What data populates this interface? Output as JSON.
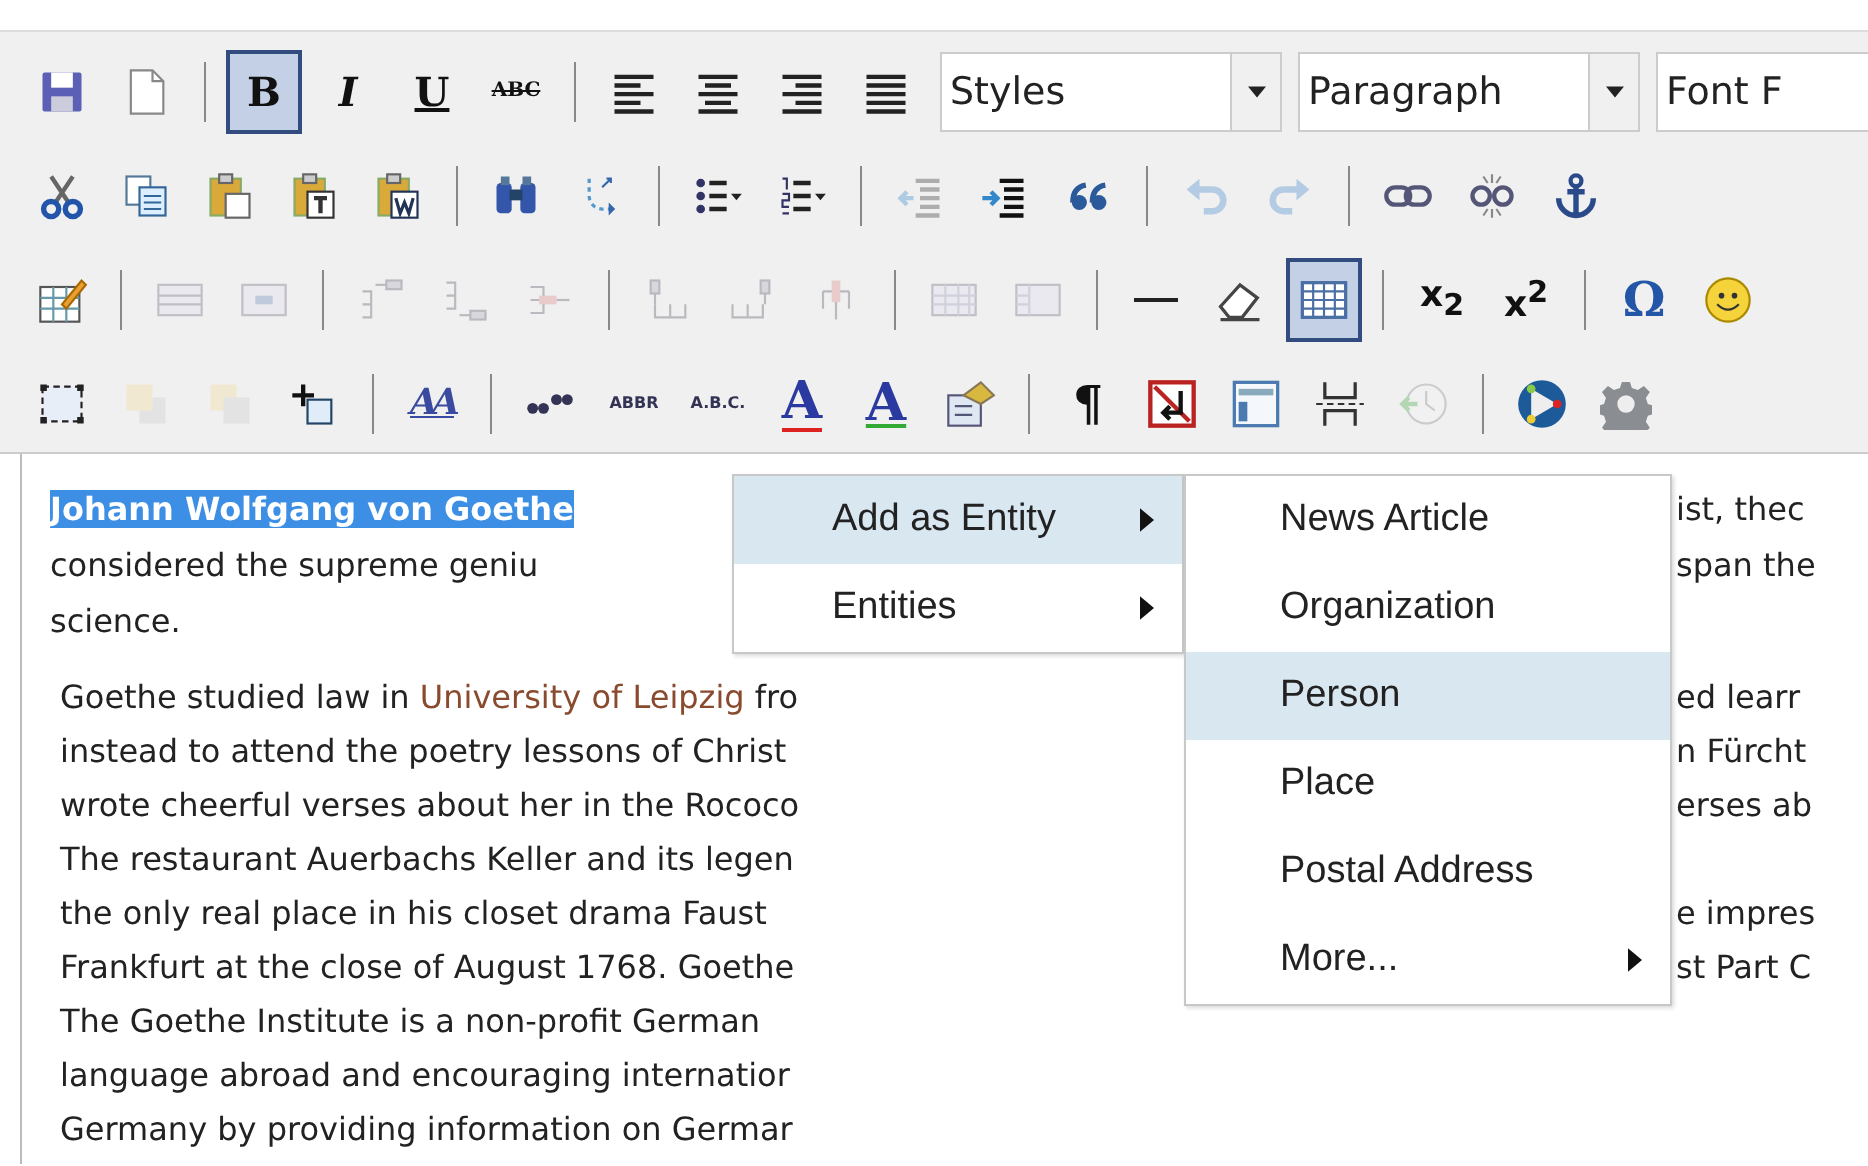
{
  "toolbar": {
    "rows": [
      [
        {
          "kind": "save",
          "pressed": false,
          "disabled": false
        },
        {
          "kind": "new",
          "pressed": false,
          "disabled": false
        },
        {
          "kind": "separator"
        },
        {
          "kind": "bold",
          "label": "B",
          "pressed": true,
          "disabled": false
        },
        {
          "kind": "italic",
          "label": "I",
          "pressed": false,
          "disabled": false
        },
        {
          "kind": "underline",
          "label": "U",
          "pressed": false,
          "disabled": false
        },
        {
          "kind": "strike",
          "label": "ABC",
          "pressed": false,
          "disabled": false
        },
        {
          "kind": "separator"
        },
        {
          "kind": "align-left",
          "pressed": false,
          "disabled": false
        },
        {
          "kind": "align-center",
          "pressed": false,
          "disabled": false
        },
        {
          "kind": "align-right",
          "pressed": false,
          "disabled": false
        },
        {
          "kind": "justify",
          "pressed": false,
          "disabled": false
        },
        {
          "kind": "dropdown",
          "value": "Styles"
        },
        {
          "kind": "dropdown",
          "value": "Paragraph"
        },
        {
          "kind": "dropdown",
          "value": "Font F"
        }
      ],
      [
        {
          "kind": "cut",
          "pressed": false,
          "disabled": false
        },
        {
          "kind": "copy",
          "pressed": false,
          "disabled": false
        },
        {
          "kind": "paste",
          "pressed": false,
          "disabled": false
        },
        {
          "kind": "paste-text",
          "pressed": false,
          "disabled": false
        },
        {
          "kind": "paste-word",
          "pressed": false,
          "disabled": false
        },
        {
          "kind": "separator"
        },
        {
          "kind": "find",
          "pressed": false,
          "disabled": false
        },
        {
          "kind": "replace",
          "pressed": false,
          "disabled": false
        },
        {
          "kind": "separator"
        },
        {
          "kind": "bullets",
          "pressed": false,
          "disabled": false
        },
        {
          "kind": "numbers",
          "pressed": false,
          "disabled": false
        },
        {
          "kind": "separator"
        },
        {
          "kind": "outdent",
          "pressed": false,
          "disabled": true
        },
        {
          "kind": "indent",
          "pressed": false,
          "disabled": false
        },
        {
          "kind": "blockquote",
          "pressed": false,
          "disabled": false
        },
        {
          "kind": "separator"
        },
        {
          "kind": "undo",
          "pressed": false,
          "disabled": true
        },
        {
          "kind": "redo",
          "pressed": false,
          "disabled": true
        },
        {
          "kind": "separator"
        },
        {
          "kind": "link",
          "pressed": false,
          "disabled": false
        },
        {
          "kind": "unlink",
          "pressed": false,
          "disabled": false
        },
        {
          "kind": "anchor",
          "pressed": false,
          "disabled": false
        }
      ],
      [
        {
          "kind": "table-edit",
          "pressed": false,
          "disabled": false
        },
        {
          "kind": "separator"
        },
        {
          "kind": "row-props",
          "pressed": false,
          "disabled": true
        },
        {
          "kind": "cell-props",
          "pressed": false,
          "disabled": true
        },
        {
          "kind": "separator"
        },
        {
          "kind": "row-before",
          "pressed": false,
          "disabled": true
        },
        {
          "kind": "row-after",
          "pressed": false,
          "disabled": true
        },
        {
          "kind": "row-delete",
          "pressed": false,
          "disabled": true
        },
        {
          "kind": "separator"
        },
        {
          "kind": "col-before",
          "pressed": false,
          "disabled": true
        },
        {
          "kind": "col-after",
          "pressed": false,
          "disabled": true
        },
        {
          "kind": "col-delete",
          "pressed": false,
          "disabled": true
        },
        {
          "kind": "separator"
        },
        {
          "kind": "split",
          "pressed": false,
          "disabled": true
        },
        {
          "kind": "merge",
          "pressed": false,
          "disabled": true
        },
        {
          "kind": "separator"
        },
        {
          "kind": "hr",
          "pressed": false,
          "disabled": false
        },
        {
          "kind": "eraser",
          "pressed": false,
          "disabled": false
        },
        {
          "kind": "table",
          "pressed": true,
          "disabled": false
        },
        {
          "kind": "separator"
        },
        {
          "kind": "sub",
          "label": "x$_{2}$",
          "pressed": false,
          "disabled": false
        },
        {
          "kind": "sup",
          "label": "x$^{2}$",
          "pressed": false,
          "disabled": false
        },
        {
          "kind": "separator"
        },
        {
          "kind": "omega",
          "label": "Ω",
          "pressed": false,
          "disabled": false
        },
        {
          "kind": "smiley",
          "pressed": false,
          "disabled": false
        }
      ],
      [
        {
          "kind": "layer",
          "pressed": false,
          "disabled": false
        },
        {
          "kind": "forward",
          "pressed": false,
          "disabled": true
        },
        {
          "kind": "backward",
          "pressed": false,
          "disabled": true
        },
        {
          "kind": "absolute",
          "pressed": false,
          "disabled": false
        },
        {
          "kind": "separator"
        },
        {
          "kind": "styleprops",
          "label": "AA",
          "pressed": false,
          "disabled": false
        },
        {
          "kind": "separator"
        },
        {
          "kind": "cite",
          "pressed": false,
          "disabled": false
        },
        {
          "kind": "abbr",
          "label": "ABBR",
          "pressed": false,
          "disabled": false
        },
        {
          "kind": "acronym",
          "label": "A.B.C.",
          "pressed": false,
          "disabled": false
        },
        {
          "kind": "del",
          "label": "A",
          "pressed": false,
          "disabled": false
        },
        {
          "kind": "ins",
          "label": "A",
          "pressed": false,
          "disabled": false
        },
        {
          "kind": "attribs",
          "pressed": false,
          "disabled": false
        },
        {
          "kind": "separator"
        },
        {
          "kind": "pilcrow",
          "label": "¶",
          "pressed": false,
          "disabled": false
        },
        {
          "kind": "nonbreaking",
          "pressed": false,
          "disabled": false
        },
        {
          "kind": "template",
          "pressed": false,
          "disabled": false
        },
        {
          "kind": "pagebreak",
          "pressed": false,
          "disabled": false
        },
        {
          "kind": "restore",
          "pressed": false,
          "disabled": true
        },
        {
          "kind": "separator"
        },
        {
          "kind": "play",
          "pressed": false,
          "disabled": false
        },
        {
          "kind": "gear",
          "pressed": false,
          "disabled": false
        }
      ]
    ]
  },
  "editor": {
    "paragraphs": [
      {
        "lines": [
          {
            "segments": [
              {
                "kind": "selected",
                "text": "Johann Wolfgang von Goethe"
              }
            ],
            "right": "ist, thec"
          },
          {
            "segments": [
              {
                "kind": "plain",
                "text": "considered the supreme geniu"
              }
            ],
            "right": "span the"
          },
          {
            "segments": [
              {
                "kind": "plain",
                "text": "science."
              }
            ]
          }
        ]
      },
      {
        "lines": [
          {
            "segments": [
              {
                "kind": "plain",
                "text": "Goethe studied law in "
              },
              {
                "kind": "entity",
                "text": "University of Leipzig"
              },
              {
                "kind": "plain",
                "text": " fro"
              }
            ],
            "right": "ed learr"
          },
          {
            "segments": [
              {
                "kind": "plain",
                "text": "instead to attend the poetry lessons of Christ"
              }
            ],
            "right": "n Fürcht"
          },
          {
            "segments": [
              {
                "kind": "plain",
                "text": "wrote cheerful verses about her in the Rococo"
              }
            ],
            "right": "erses ab"
          },
          {
            "segments": [
              {
                "kind": "plain",
                "text": "The restaurant Auerbachs Keller and its legen"
              }
            ]
          },
          {
            "segments": [
              {
                "kind": "plain",
                "text": "the only real place in his closet drama Faust"
              }
            ],
            "right": "e impres"
          },
          {
            "segments": [
              {
                "kind": "plain",
                "text": "Frankfurt at the close of August 1768. Goethe"
              }
            ],
            "right": "st Part C"
          },
          {
            "segments": [
              {
                "kind": "plain",
                "text": "The Goethe Institute is a non-profit German"
              }
            ]
          },
          {
            "segments": [
              {
                "kind": "plain",
                "text": "language abroad and encouraging internatior"
              }
            ]
          },
          {
            "segments": [
              {
                "kind": "plain",
                "text": "Germany by providing information on Germar"
              }
            ]
          }
        ]
      }
    ]
  },
  "context_menu": {
    "items": [
      {
        "label": "Add as Entity",
        "selected": true,
        "submenu": true
      },
      {
        "label": "Entities",
        "selected": false,
        "submenu": true
      }
    ]
  },
  "submenu": {
    "items": [
      {
        "label": "News Article",
        "selected": false,
        "submenu": false
      },
      {
        "label": "Organization",
        "selected": false,
        "submenu": false
      },
      {
        "label": "Person",
        "selected": true,
        "submenu": false
      },
      {
        "label": "Place",
        "selected": false,
        "submenu": false
      },
      {
        "label": "Postal Address",
        "selected": false,
        "submenu": false
      },
      {
        "label": "More...",
        "selected": false,
        "submenu": true
      }
    ]
  }
}
